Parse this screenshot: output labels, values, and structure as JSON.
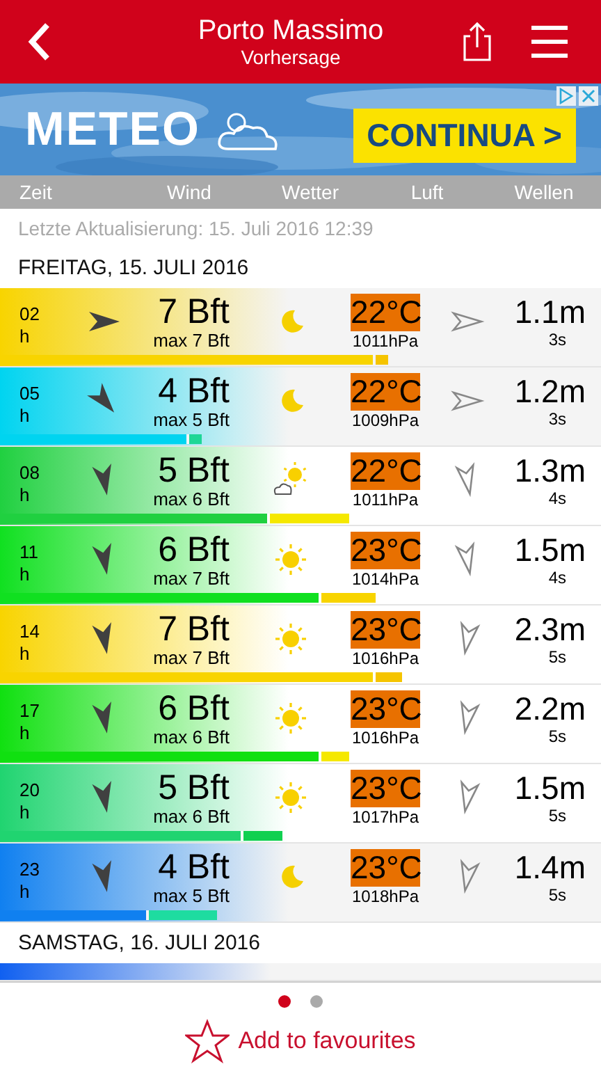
{
  "header": {
    "title": "Porto Massimo",
    "subtitle": "Vorhersage"
  },
  "ad": {
    "brand": "METEO",
    "button": "CONTINUA >"
  },
  "columns": [
    "Zeit",
    "Wind",
    "Wetter",
    "Luft",
    "Wellen"
  ],
  "last_update": "Letzte Aktualisierung: 15. Juli 2016 12:39",
  "days": [
    {
      "title": "FREITAG, 15. JULI 2016",
      "rows": [
        {
          "hour": "02",
          "unit": "h",
          "color": "#f8d400",
          "wind_arrow": {
            "kind": "east"
          },
          "wind": "7 Bft",
          "gust": "max 7 Bft",
          "weather": {
            "kind": "moon"
          },
          "temp": "22°C",
          "pressure": "1011hPa",
          "wave_arrow": {
            "kind": "east"
          },
          "wave": "1.1m",
          "period": "3s",
          "wind_bar": {
            "level": 0.62
          },
          "gust_bar": {
            "level": 0.645,
            "color": "#f5c400"
          }
        },
        {
          "hour": "05",
          "unit": "h",
          "color": "#00d4f0",
          "wind_arrow": {
            "kind": "southeast"
          },
          "wind": "4 Bft",
          "gust": "max 5 Bft",
          "weather": {
            "kind": "moon"
          },
          "temp": "22°C",
          "pressure": "1009hPa",
          "wave_arrow": {
            "kind": "east"
          },
          "wave": "1.2m",
          "period": "3s",
          "wind_bar": {
            "level": 0.31
          },
          "gust_bar": {
            "level": 0.335,
            "color": "#1ed796"
          }
        },
        {
          "hour": "08",
          "unit": "h",
          "color": "#20d040",
          "wind_arrow": {
            "kind": "south"
          },
          "wind": "5 Bft",
          "gust": "max 6 Bft",
          "weather": {
            "kind": "suncloud"
          },
          "temp": "22°C",
          "pressure": "1011hPa",
          "wave_arrow": {
            "kind": "south"
          },
          "wave": "1.3m",
          "period": "4s",
          "wind_bar": {
            "level": 0.445
          },
          "gust_bar": {
            "level": 0.58,
            "color": "#f5e800"
          }
        },
        {
          "hour": "11",
          "unit": "h",
          "color": "#10e020",
          "wind_arrow": {
            "kind": "south"
          },
          "wind": "6 Bft",
          "gust": "max 7 Bft",
          "weather": {
            "kind": "sun"
          },
          "temp": "23°C",
          "pressure": "1014hPa",
          "wave_arrow": {
            "kind": "south"
          },
          "wave": "1.5m",
          "period": "4s",
          "wind_bar": {
            "level": 0.53
          },
          "gust_bar": {
            "level": 0.625,
            "color": "#f8d400"
          }
        },
        {
          "hour": "14",
          "unit": "h",
          "color": "#f8d400",
          "wind_arrow": {
            "kind": "south"
          },
          "wind": "7 Bft",
          "gust": "max 7 Bft",
          "weather": {
            "kind": "sun"
          },
          "temp": "23°C",
          "pressure": "1016hPa",
          "wave_arrow": {
            "kind": "southwest"
          },
          "wave": "2.3m",
          "period": "5s",
          "wind_bar": {
            "level": 0.62
          },
          "gust_bar": {
            "level": 0.67,
            "color": "#f5c400"
          }
        },
        {
          "hour": "17",
          "unit": "h",
          "color": "#10e010",
          "wind_arrow": {
            "kind": "south"
          },
          "wind": "6 Bft",
          "gust": "max 6 Bft",
          "weather": {
            "kind": "sun"
          },
          "temp": "23°C",
          "pressure": "1016hPa",
          "wave_arrow": {
            "kind": "southwest"
          },
          "wave": "2.2m",
          "period": "5s",
          "wind_bar": {
            "level": 0.53
          },
          "gust_bar": {
            "level": 0.58,
            "color": "#f5e800"
          }
        },
        {
          "hour": "20",
          "unit": "h",
          "color": "#20d470",
          "wind_arrow": {
            "kind": "south"
          },
          "wind": "5 Bft",
          "gust": "max 6 Bft",
          "weather": {
            "kind": "sun"
          },
          "temp": "23°C",
          "pressure": "1017hPa",
          "wave_arrow": {
            "kind": "southwest"
          },
          "wave": "1.5m",
          "period": "5s",
          "wind_bar": {
            "level": 0.4
          },
          "gust_bar": {
            "level": 0.47,
            "color": "#10d050"
          }
        },
        {
          "hour": "23",
          "unit": "h",
          "color": "#1080f0",
          "wind_arrow": {
            "kind": "south"
          },
          "wind": "4 Bft",
          "gust": "max 5 Bft",
          "weather": {
            "kind": "moon"
          },
          "temp": "23°C",
          "pressure": "1018hPa",
          "wave_arrow": {
            "kind": "southwest"
          },
          "wave": "1.4m",
          "period": "5s",
          "wind_bar": {
            "level": 0.243
          },
          "gust_bar": {
            "level": 0.36,
            "color": "#1edca0"
          }
        }
      ]
    },
    {
      "title": "SAMSTAG, 16. JULI 2016",
      "rows": [
        {
          "kind": "partial",
          "color": "#1060f0"
        }
      ]
    }
  ],
  "pages": [
    {
      "selected": true
    },
    {
      "selected": false
    }
  ],
  "favourite": "Add to favourites"
}
